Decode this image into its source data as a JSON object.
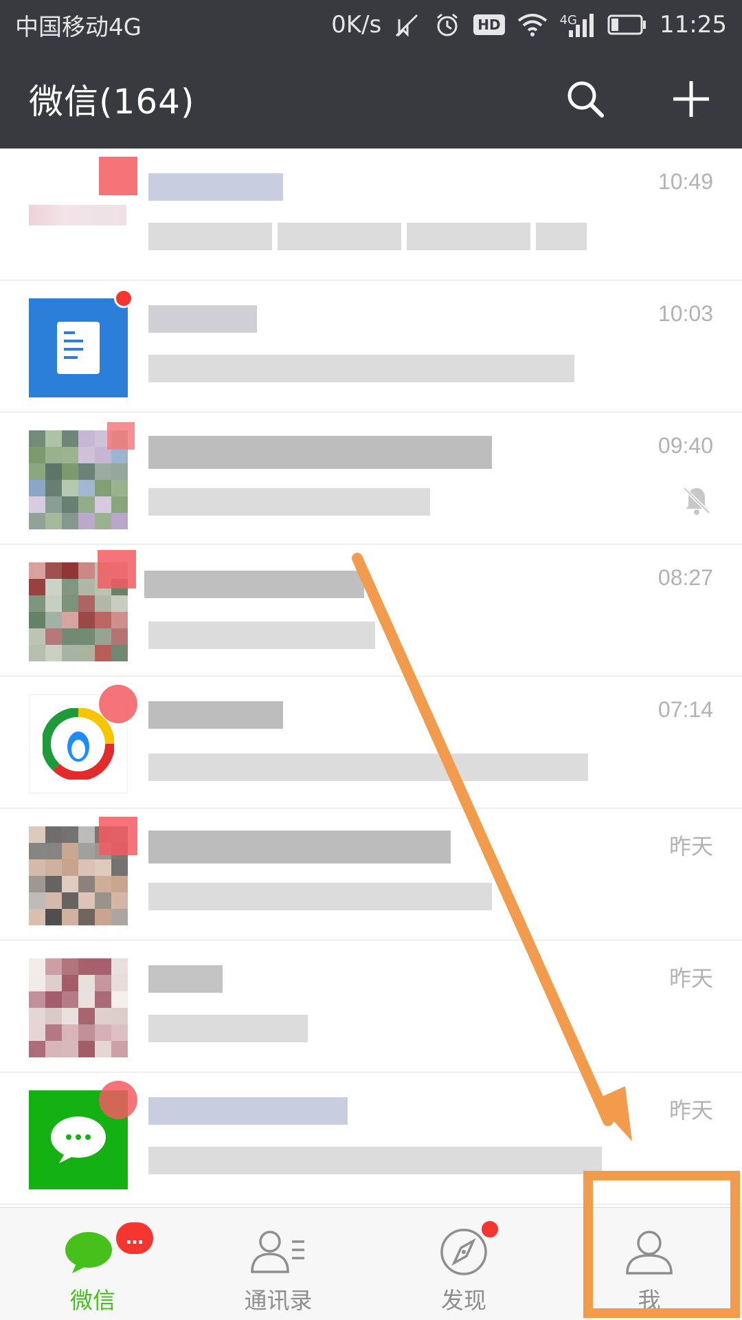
{
  "status_bar": {
    "carrier": "中国移动4G",
    "speed": "0K/s",
    "hd": "HD",
    "network": "4G",
    "time": "11:25"
  },
  "header": {
    "title": "微信(164)",
    "icons": [
      "search-icon",
      "plus-icon"
    ]
  },
  "chats": [
    {
      "time": "10:49",
      "avatar_colors": [
        "#ffffff",
        "#f4e9ec",
        "#e8cfd6"
      ],
      "muted": false
    },
    {
      "time": "10:03",
      "avatar_colors": [
        "#2b7fd8"
      ],
      "muted": false
    },
    {
      "time": "09:40",
      "avatar_colors": [
        "#6b8fb5",
        "#7a9a6a",
        "#b7a4c8",
        "#4d6a5a"
      ],
      "muted": true
    },
    {
      "time": "08:27",
      "avatar_colors": [
        "#b85a55",
        "#5f7a5e",
        "#8c2a2a",
        "#a6b09a"
      ],
      "muted": false
    },
    {
      "time": "07:14",
      "avatar_colors": [
        "#ffffff"
      ],
      "muted": false
    },
    {
      "time": "昨天",
      "avatar_colors": [
        "#8b8a86",
        "#6d6259",
        "#c7a28d",
        "#3a3836"
      ],
      "muted": false
    },
    {
      "time": "昨天",
      "avatar_colors": [
        "#c99a9f",
        "#d9c8c4",
        "#a25b67",
        "#efe9e4"
      ],
      "muted": false
    },
    {
      "time": "昨天",
      "avatar_colors": [
        "#13b212"
      ],
      "muted": false
    }
  ],
  "bottom_nav": {
    "tabs": [
      {
        "label": "微信",
        "icon": "chat-bubbles-icon",
        "badge": "…",
        "active": true
      },
      {
        "label": "通讯录",
        "icon": "contacts-icon",
        "active": false
      },
      {
        "label": "发现",
        "icon": "compass-icon",
        "dot": true,
        "active": false
      },
      {
        "label": "我",
        "icon": "person-icon",
        "active": false
      }
    ]
  },
  "colors": {
    "header_bg": "#393a3f",
    "accent_green": "#46c01b",
    "badge_red": "#f43530",
    "annotation_orange": "#f29b4c"
  }
}
